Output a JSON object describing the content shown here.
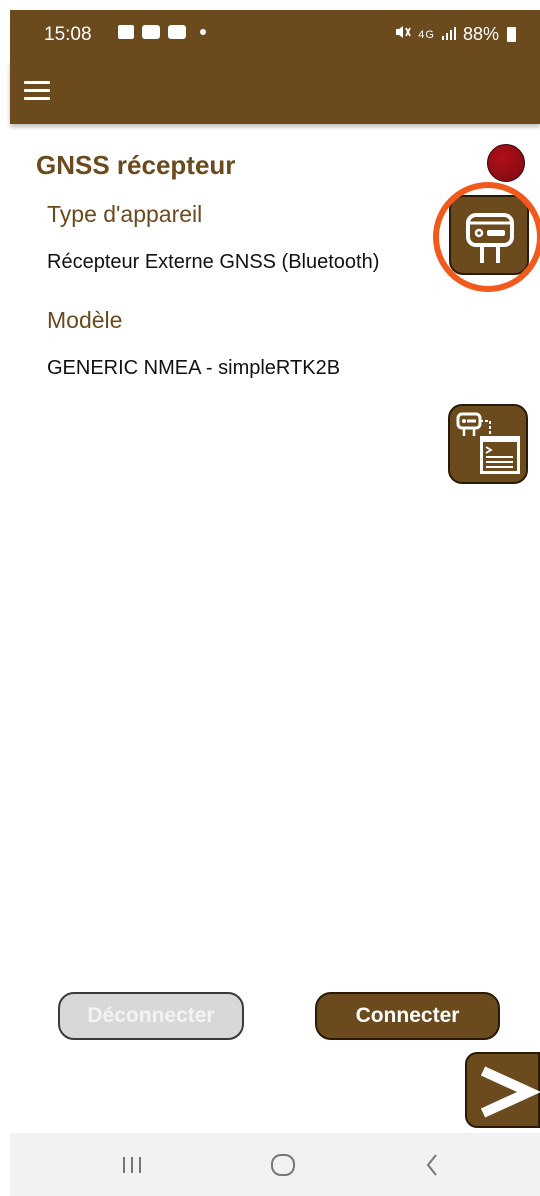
{
  "status_bar": {
    "time": "15:08",
    "network": "4G",
    "battery": "88%"
  },
  "app_bar": {
    "menu_icon": "hamburger-menu-icon"
  },
  "section": {
    "title": "GNSS récepteur",
    "status_color": "#8b0d14"
  },
  "device_type": {
    "label": "Type d'appareil",
    "value": "Récepteur Externe GNSS (Bluetooth)",
    "button_icon": "gnss-receiver-icon"
  },
  "model": {
    "label": "Modèle",
    "value": "GENERIC NMEA - simpleRTK2B",
    "button_icon": "receiver-config-icon"
  },
  "actions": {
    "disconnect_label": "Déconnecter",
    "connect_label": "Connecter",
    "next_icon": "chevron-right-icon"
  },
  "nav": {
    "recents_icon": "recents-icon",
    "home_icon": "home-icon",
    "back_icon": "back-icon"
  },
  "colors": {
    "brand": "#6b4a1e",
    "highlight": "#f15a1c",
    "status_dot": "#8b0d14"
  }
}
